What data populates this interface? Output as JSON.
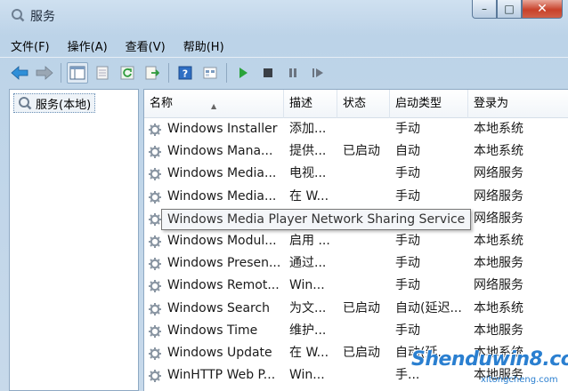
{
  "window": {
    "title": "服务"
  },
  "caption_buttons": {
    "minimize": "–",
    "maximize": "□",
    "close": "✕"
  },
  "menu": [
    "文件(F)",
    "操作(A)",
    "查看(V)",
    "帮助(H)"
  ],
  "toolbar_icons": [
    "back-icon",
    "forward-icon",
    "console-tree-icon",
    "properties-icon",
    "refresh-icon",
    "export-icon",
    "help-icon",
    "view-icon",
    "start-icon",
    "stop-icon",
    "pause-icon",
    "restart-icon"
  ],
  "tree": {
    "root": "服务(本地)"
  },
  "columns": [
    "名称",
    "描述",
    "状态",
    "启动类型",
    "登录为"
  ],
  "rows": [
    {
      "name": "Windows Installer",
      "desc": "添加...",
      "status": "",
      "startup": "手动",
      "logon": "本地系统"
    },
    {
      "name": "Windows Mana...",
      "desc": "提供...",
      "status": "已启动",
      "startup": "自动",
      "logon": "本地系统"
    },
    {
      "name": "Windows Media...",
      "desc": "电视...",
      "status": "",
      "startup": "手动",
      "logon": "网络服务"
    },
    {
      "name": "Windows Media...",
      "desc": "在 W...",
      "status": "",
      "startup": "手动",
      "logon": "网络服务"
    },
    {
      "name": "",
      "desc": "",
      "status": "",
      "startup": "",
      "logon": "网络服务"
    },
    {
      "name": "Windows Modul...",
      "desc": "启用 ...",
      "status": "",
      "startup": "手动",
      "logon": "本地系统"
    },
    {
      "name": "Windows Presen...",
      "desc": "通过...",
      "status": "",
      "startup": "手动",
      "logon": "本地服务"
    },
    {
      "name": "Windows Remot...",
      "desc": "Win...",
      "status": "",
      "startup": "手动",
      "logon": "网络服务"
    },
    {
      "name": "Windows Search",
      "desc": "为文...",
      "status": "已启动",
      "startup": "自动(延迟...",
      "logon": "本地系统"
    },
    {
      "name": "Windows Time",
      "desc": "维护...",
      "status": "",
      "startup": "手动",
      "logon": "本地服务"
    },
    {
      "name": "Windows Update",
      "desc": "在 W...",
      "status": "已启动",
      "startup": "自动(延...",
      "logon": "本地系统"
    },
    {
      "name": "WinHTTP Web P...",
      "desc": "Win...",
      "status": "",
      "startup": "手...",
      "logon": "本地服务"
    }
  ],
  "tooltip": "Windows Media Player Network Sharing Service",
  "watermark": {
    "main": "Shenduwin8.com",
    "sub": "xitongcheng.com"
  },
  "colors": {
    "accent": "#2a7fd0",
    "frame": "#c9dbea"
  }
}
